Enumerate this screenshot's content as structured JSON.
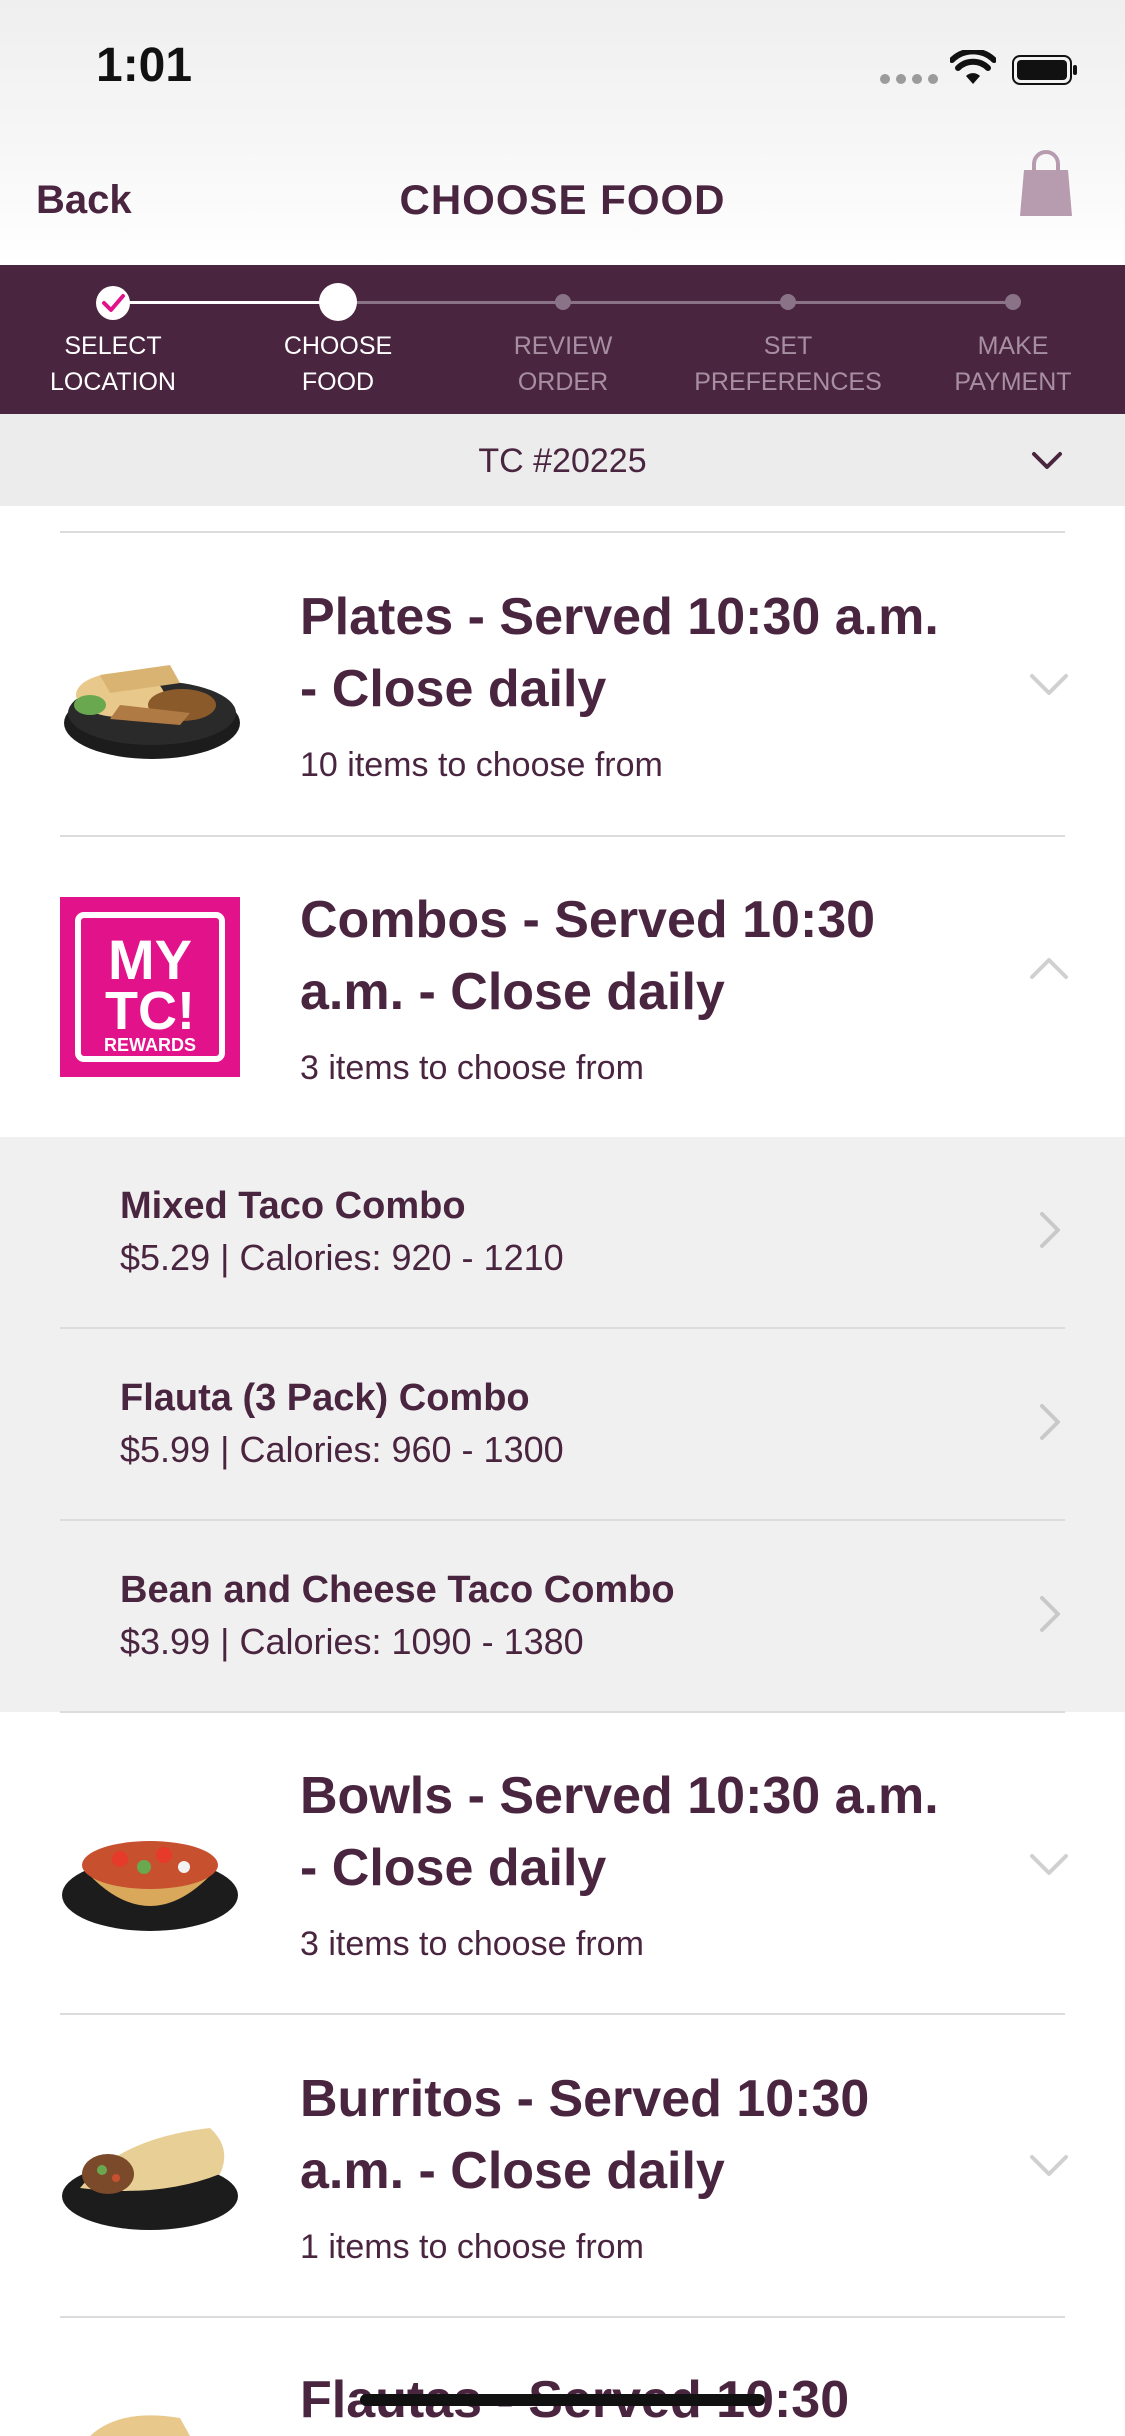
{
  "status_bar": {
    "time": "1:01"
  },
  "nav": {
    "back_label": "Back",
    "title": "CHOOSE FOOD"
  },
  "stepper": {
    "steps": [
      {
        "line1": "SELECT",
        "line2": "LOCATION",
        "state": "done"
      },
      {
        "line1": "CHOOSE",
        "line2": "FOOD",
        "state": "current"
      },
      {
        "line1": "REVIEW",
        "line2": "ORDER",
        "state": "upcoming"
      },
      {
        "line1": "SET",
        "line2": "PREFERENCES",
        "state": "upcoming"
      },
      {
        "line1": "MAKE",
        "line2": "PAYMENT",
        "state": "upcoming"
      }
    ]
  },
  "store": {
    "label": "TC #20225"
  },
  "categories": [
    {
      "line1": "Plates  -   Served 10:30 a.m.",
      "line2": "- Close daily",
      "count": "10 items to choose from",
      "icon": "plate-food-image"
    },
    {
      "line1": "Combos  -   Served 10:30",
      "line2": "a.m. - Close daily",
      "count": "3 items to choose from",
      "icon": "my-tc-rewards-logo",
      "logo_text": [
        "MY",
        "TC!",
        "REWARDS"
      ]
    },
    {
      "line1": "Bowls  -   Served 10:30 a.m.",
      "line2": "- Close daily",
      "count": "3 items to choose from",
      "icon": "bowl-food-image"
    },
    {
      "line1": "Burritos  -   Served 10:30",
      "line2": "a.m. - Close daily",
      "count": "1 items to choose from",
      "icon": "burrito-food-image"
    },
    {
      "line1": "Flautas  -   Served 10:30",
      "icon": "flauta-food-image"
    }
  ],
  "combo_items": [
    {
      "name": "Mixed Taco Combo",
      "meta": "$5.29 | Calories: 920 - 1210"
    },
    {
      "name": "Flauta (3 Pack) Combo",
      "meta": "$5.99 | Calories: 960 - 1300"
    },
    {
      "name": "Bean and Cheese Taco Combo",
      "meta": "$3.99 | Calories: 1090 - 1380"
    }
  ],
  "colors": {
    "brand_purple": "#4a2540",
    "rewards_pink": "#e2128a",
    "chevron_gray": "#c9c9c9"
  }
}
